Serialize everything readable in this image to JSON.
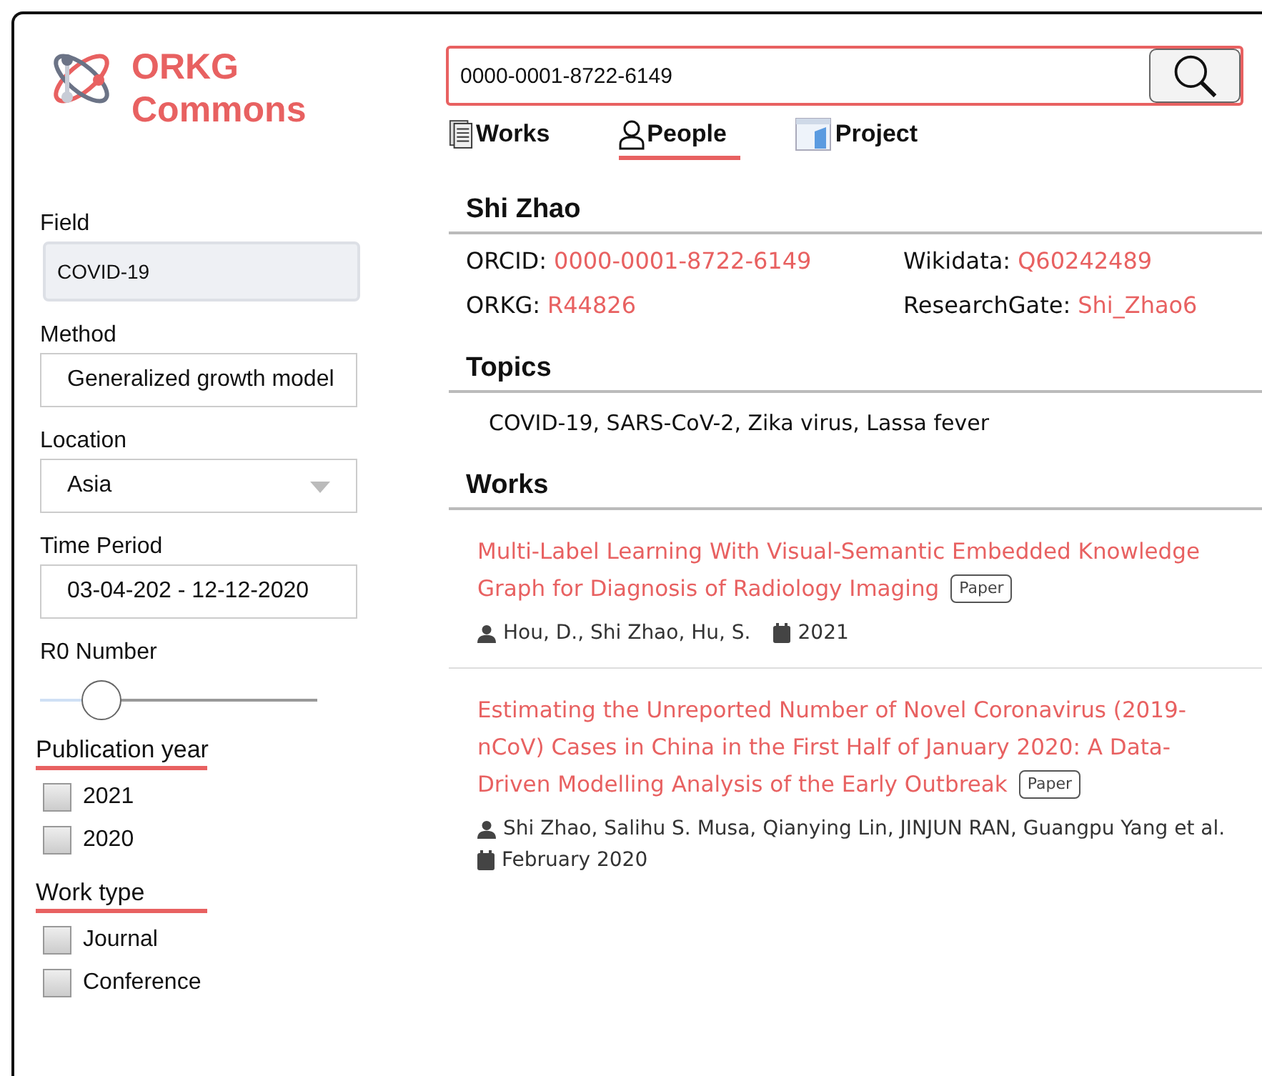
{
  "logo": {
    "line1": "ORKG",
    "line2": "Commons"
  },
  "search": {
    "value": "0000-0001-8722-6149"
  },
  "tabs": [
    {
      "label": "Works",
      "kind": "works",
      "selected": false
    },
    {
      "label": "People",
      "kind": "people",
      "selected": true
    },
    {
      "label": "Project",
      "kind": "project",
      "selected": false
    }
  ],
  "filters": [
    {
      "label": "Field",
      "kind": "text",
      "value": "COVID-19"
    },
    {
      "label": "Method",
      "kind": "select",
      "value": "Generalized growth model"
    },
    {
      "label": "Location",
      "kind": "dropdown",
      "value": "Asia"
    },
    {
      "label": "Time Period",
      "kind": "select",
      "value": "03-04-202 - 12-12-2020"
    },
    {
      "label": "R0 Number",
      "kind": "slider",
      "level": 0.22
    }
  ],
  "checkgroups": [
    {
      "title": "Publication year",
      "options": [
        {
          "label": "2021",
          "checked": false
        },
        {
          "label": "2020",
          "checked": false
        }
      ]
    },
    {
      "title": "Work type",
      "options": [
        {
          "label": "Journal",
          "checked": false
        },
        {
          "label": "Conference",
          "checked": false
        }
      ]
    }
  ],
  "person": {
    "name": "Shi Zhao",
    "ids": [
      {
        "label": "ORCID:",
        "value": "0000-0001-8722-6149"
      },
      {
        "label": "Wikidata:",
        "value": "Q60242489"
      },
      {
        "label": "ORKG:",
        "value": "R44826"
      },
      {
        "label": "ResearchGate:",
        "value": "Shi_Zhao6"
      }
    ]
  },
  "topics": {
    "title": "Topics",
    "text": "COVID-19, SARS-CoV-2, Zika virus, Lassa fever"
  },
  "works": {
    "title": "Works",
    "items": [
      {
        "title": "Multi-Label Learning With Visual-Semantic Embedded Knowledge Graph for Diagnosis of Radiology Imaging",
        "badge": "Paper",
        "authors": "Hou, D., Shi Zhao, Hu, S.",
        "date": "2021"
      },
      {
        "title": "Estimating the Unreported Number of Novel Coronavirus (2019-nCoV) Cases in China in the First Half of January 2020: A Data-Driven Modelling Analysis of the Early Outbreak",
        "badge": "Paper",
        "authors": "Shi Zhao, Salihu S. Musa, Qianying Lin, JINJUN RAN, Guangpu Yang et al.",
        "date": "February 2020"
      }
    ]
  }
}
